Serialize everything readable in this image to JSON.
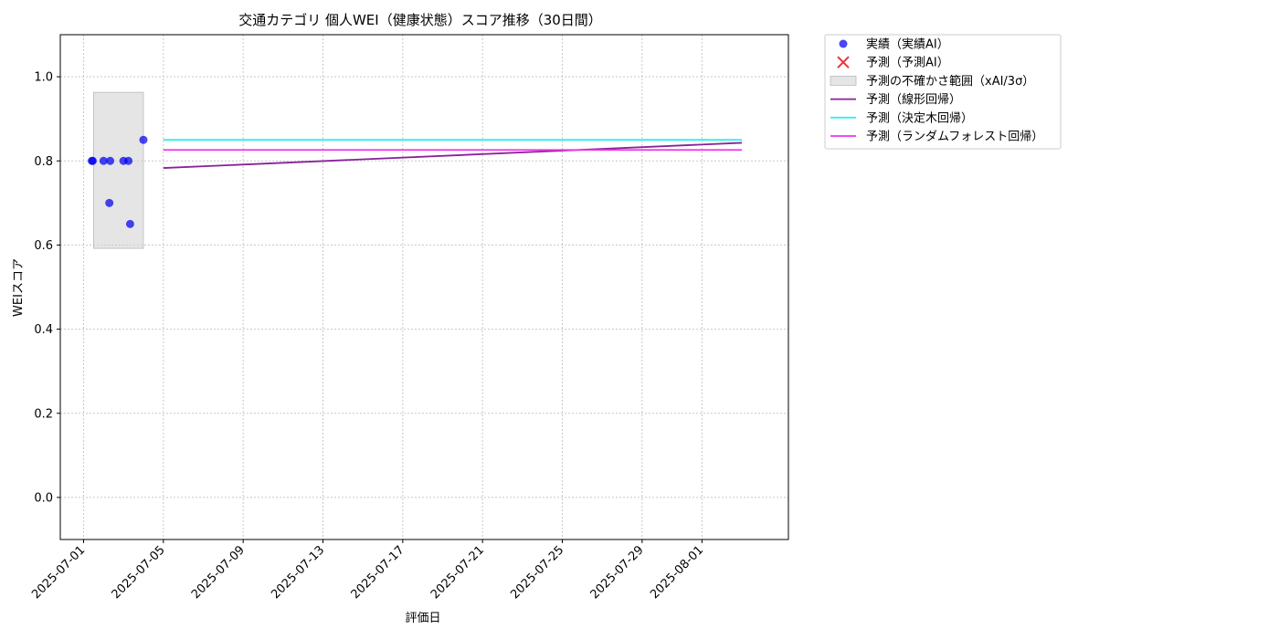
{
  "chart_data": {
    "type": "scatter",
    "title": "交通カテゴリ 個人WEI（健康状態）スコア推移（30日間）",
    "xlabel": "評価日",
    "ylabel": "WEIスコア",
    "x_range": [
      "2024-06-29T20:00",
      "2025-08-05T08:00"
    ],
    "xlim": [
      "2025-06-29T20:00",
      "2025-08-05T08:00"
    ],
    "ylim": [
      -0.1,
      1.1
    ],
    "yticks": [
      0.0,
      0.2,
      0.4,
      0.6,
      0.8,
      1.0
    ],
    "ytick_labels": [
      "0.0",
      "0.2",
      "0.4",
      "0.6",
      "0.8",
      "1.0"
    ],
    "xticks": [
      "2025-07-01",
      "2025-07-05",
      "2025-07-09",
      "2025-07-13",
      "2025-07-17",
      "2025-07-21",
      "2025-07-25",
      "2025-07-29",
      "2025-08-01"
    ],
    "grid": true,
    "legend_position": "outside-top-right",
    "series": [
      {
        "name": "実績（実績AI）",
        "kind": "scatter",
        "color": "#0000ee",
        "points": [
          {
            "x": "2025-07-01T10:00",
            "y": 0.8
          },
          {
            "x": "2025-07-01T11:00",
            "y": 0.8
          },
          {
            "x": "2025-07-02T00:00",
            "y": 0.8
          },
          {
            "x": "2025-07-02T08:00",
            "y": 0.8
          },
          {
            "x": "2025-07-02T07:00",
            "y": 0.7
          },
          {
            "x": "2025-07-03T00:00",
            "y": 0.8
          },
          {
            "x": "2025-07-03T06:00",
            "y": 0.8
          },
          {
            "x": "2025-07-03T08:00",
            "y": 0.65
          },
          {
            "x": "2025-07-04T00:00",
            "y": 0.85
          }
        ]
      },
      {
        "name": "予測（予測AI）",
        "kind": "marker-x",
        "color": "#ee3333",
        "points": []
      },
      {
        "name": "予測の不確かさ範囲（xAI/3σ）",
        "kind": "band",
        "color": "#d0d0d0",
        "x": [
          "2025-07-01T12:00",
          "2025-07-04T00:00"
        ],
        "y": [
          0.592,
          0.963
        ]
      },
      {
        "name": "予測（線形回帰）",
        "kind": "line",
        "color": "#882299",
        "points": [
          {
            "x": "2025-07-05T00:00",
            "y": 0.783
          },
          {
            "x": "2025-08-03T00:00",
            "y": 0.843
          }
        ]
      },
      {
        "name": "予測（決定木回帰）",
        "kind": "line",
        "color": "#33eeee",
        "points": [
          {
            "x": "2025-07-05T00:00",
            "y": 0.85
          },
          {
            "x": "2025-08-03T00:00",
            "y": 0.85
          }
        ]
      },
      {
        "name": "予測（ランダムフォレスト回帰）",
        "kind": "line",
        "color": "#ee33ee",
        "points": [
          {
            "x": "2025-07-05T00:00",
            "y": 0.826
          },
          {
            "x": "2025-08-03T00:00",
            "y": 0.826
          }
        ]
      }
    ]
  }
}
